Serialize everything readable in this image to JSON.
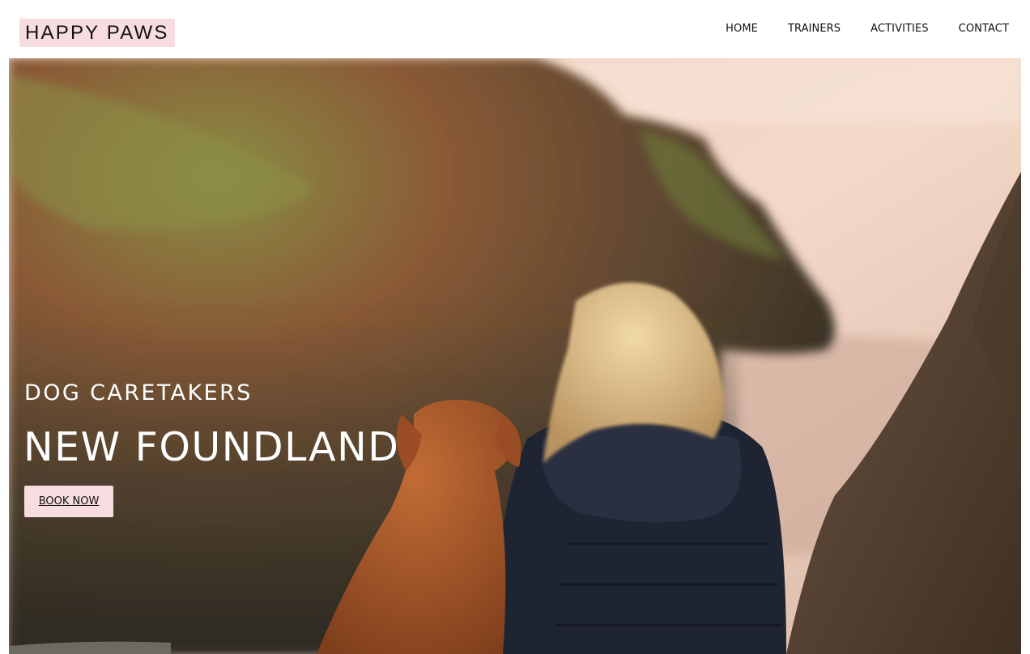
{
  "header": {
    "logo": "HAPPY PAWS",
    "nav": [
      {
        "label": "HOME"
      },
      {
        "label": "TRAINERS"
      },
      {
        "label": "ACTIVITIES"
      },
      {
        "label": "CONTACT"
      }
    ]
  },
  "hero": {
    "subtitle": "DOG CARETAKERS",
    "title": "NEW FOUNDLAND",
    "cta_label": "BOOK NOW"
  },
  "colors": {
    "accent_pink": "#f7dde0",
    "text_dark": "#111111",
    "hero_text": "#ffffff"
  }
}
